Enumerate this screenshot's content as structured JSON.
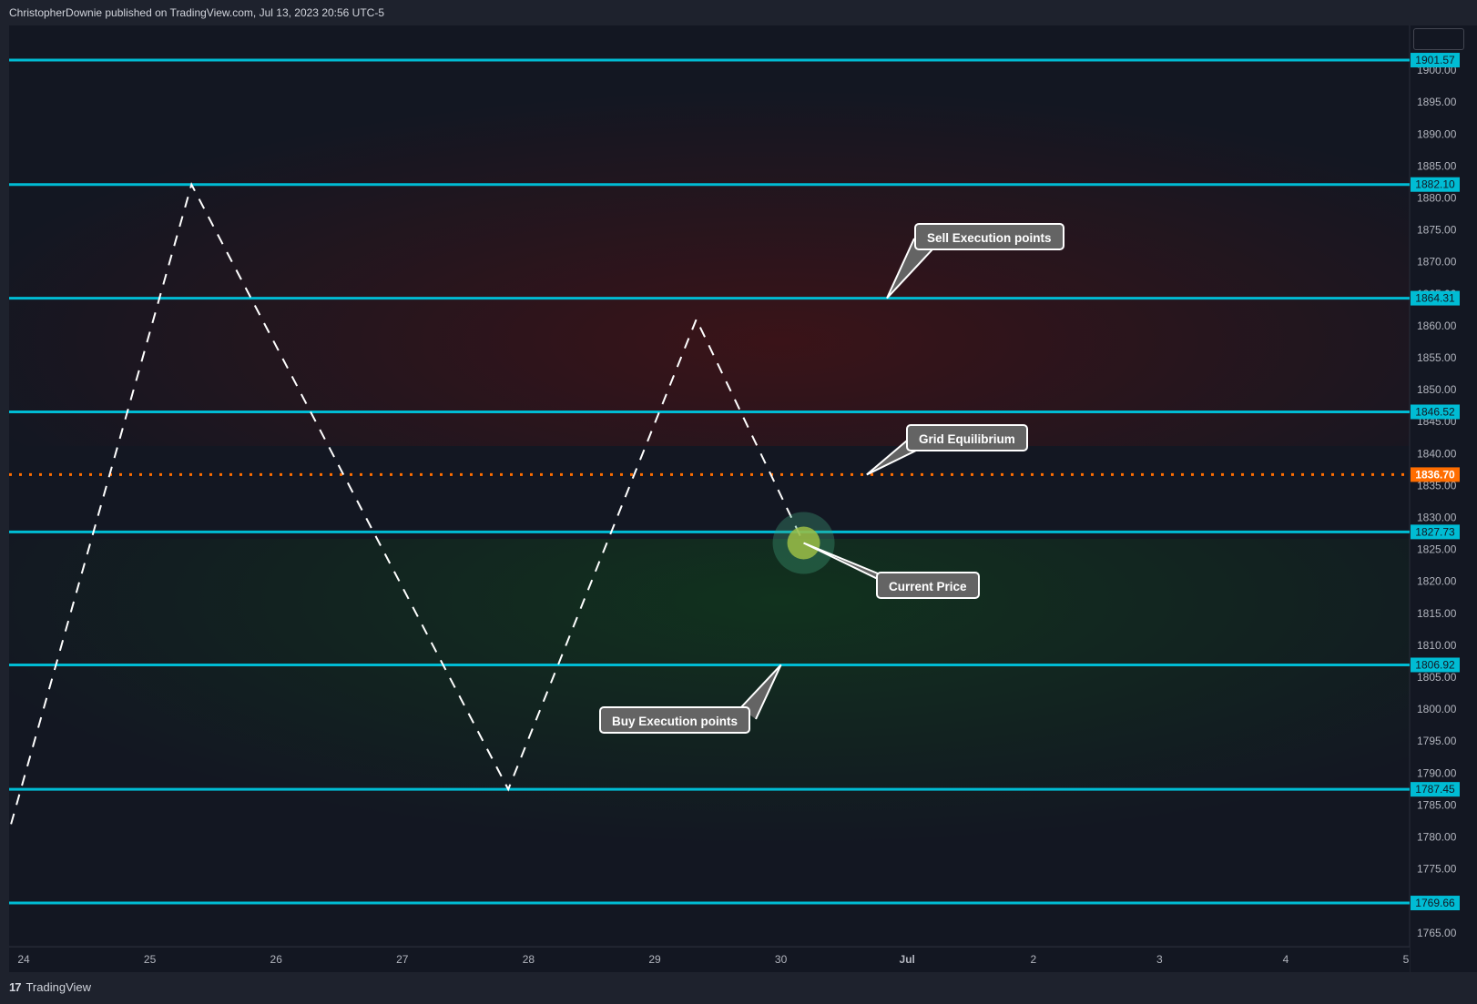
{
  "header": {
    "text": "ChristopherDownie published on TradingView.com, Jul 13, 2023 20:56 UTC-5"
  },
  "footer": {
    "brand": "TradingView",
    "logo_glyph": "17"
  },
  "colors": {
    "background": "#1e222d",
    "plot_background": "#131722",
    "grid_line": "#00bcd4",
    "equilibrium_line": "#ff6d00",
    "price_path": "#ffffff",
    "sell_zone": "#5a1010",
    "buy_zone": "#0f4d1a",
    "callout_fill": "#646464",
    "axis_text": "#b2b5be"
  },
  "chart_data": {
    "type": "line",
    "ylim": [
      1762.5,
      1905.0
    ],
    "y_ticks": [
      1765.0,
      1770.0,
      1775.0,
      1780.0,
      1785.0,
      1790.0,
      1795.0,
      1800.0,
      1805.0,
      1810.0,
      1815.0,
      1820.0,
      1825.0,
      1830.0,
      1835.0,
      1840.0,
      1845.0,
      1850.0,
      1855.0,
      1860.0,
      1865.0,
      1870.0,
      1875.0,
      1880.0,
      1885.0,
      1890.0,
      1895.0,
      1900.0
    ],
    "x_ticks": [
      "24",
      "25",
      "26",
      "27",
      "28",
      "29",
      "30",
      "Jul",
      "2",
      "3",
      "4",
      "5"
    ],
    "grid_levels": [
      {
        "value": 1901.57,
        "label": "1901.57"
      },
      {
        "value": 1882.1,
        "label": "1882.10"
      },
      {
        "value": 1864.31,
        "label": "1864.31"
      },
      {
        "value": 1846.52,
        "label": "1846.52"
      },
      {
        "value": 1827.73,
        "label": "1827.73"
      },
      {
        "value": 1806.92,
        "label": "1806.92"
      },
      {
        "value": 1787.45,
        "label": "1787.45"
      },
      {
        "value": 1769.66,
        "label": "1769.66"
      }
    ],
    "equilibrium": {
      "value": 1836.7,
      "label": "1836.70"
    },
    "price_path": [
      {
        "x": -0.1,
        "y": 1782.0
      },
      {
        "x": 1.33,
        "y": 1882.1
      },
      {
        "x": 3.84,
        "y": 1787.45
      },
      {
        "x": 5.33,
        "y": 1861.0
      },
      {
        "x": 6.18,
        "y": 1826.0
      }
    ],
    "current_price_point": {
      "x": 6.18,
      "y": 1826.0
    },
    "annotations": [
      {
        "text": "Sell Execution points",
        "x": 6.84,
        "y": 1864.31
      },
      {
        "text": "Grid Equilibrium",
        "x": 6.68,
        "y": 1836.7
      },
      {
        "text": "Current Price",
        "x": 6.18,
        "y": 1826.0
      },
      {
        "text": "Buy Execution points",
        "x": 6.0,
        "y": 1806.92
      }
    ]
  }
}
